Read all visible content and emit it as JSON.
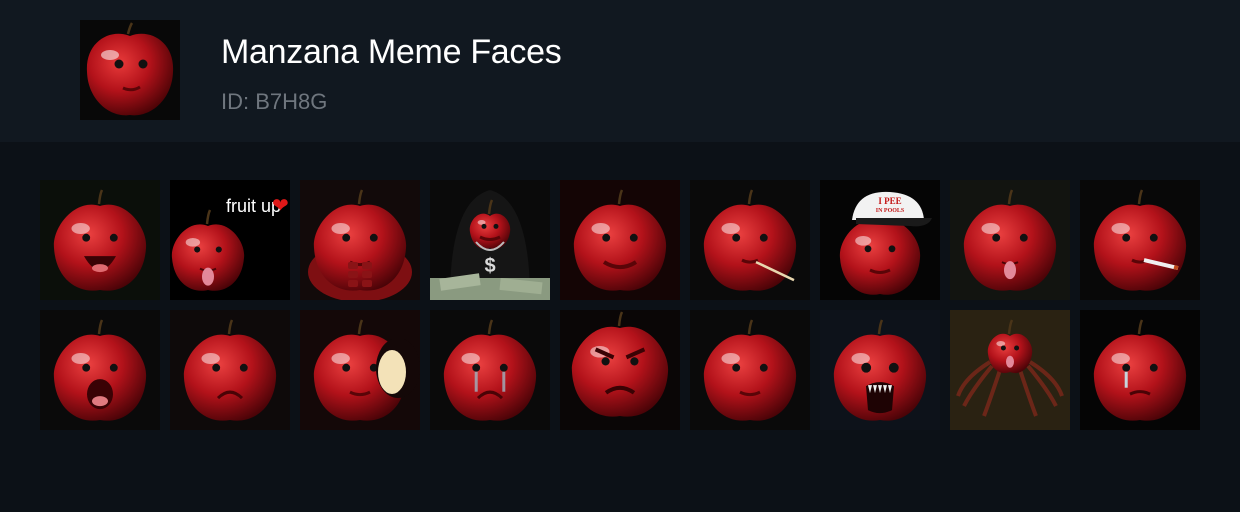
{
  "pack": {
    "title": "Manzana Meme Faces",
    "id_text": "ID: B7H8G",
    "thumbnail_icon": "apple-face-icon"
  },
  "colors": {
    "background": "#0c1117",
    "header": "#111820",
    "apple_red": "#b3121a",
    "title": "#ffffff",
    "subtitle": "#6f767e"
  },
  "stickers": [
    {
      "name": "apple-laughing",
      "expr": "laugh",
      "bg": "#0b0f0a"
    },
    {
      "name": "apple-fruit-up",
      "expr": "tongue",
      "bg": "#000000",
      "caption": "fruit up",
      "caption_emoji": "❤"
    },
    {
      "name": "apple-muscular",
      "expr": "muscle",
      "bg": "#120a0a"
    },
    {
      "name": "apple-hoodie-money",
      "expr": "hoodie",
      "bg": "#0a0a0a",
      "chain_text": "$"
    },
    {
      "name": "apple-smug",
      "expr": "smug",
      "bg": "#140505"
    },
    {
      "name": "apple-toothpick",
      "expr": "toothpick",
      "bg": "#0a0a0a"
    },
    {
      "name": "apple-trucker-cap",
      "expr": "cap",
      "bg": "#050505",
      "cap_text_1": "I PEE",
      "cap_text_2": "IN POOLS"
    },
    {
      "name": "apple-tongue-out",
      "expr": "tongue",
      "bg": "#121410"
    },
    {
      "name": "apple-cigarette",
      "expr": "cigarette",
      "bg": "#080808"
    },
    {
      "name": "apple-shocked",
      "expr": "shock",
      "bg": "#0a0a0a"
    },
    {
      "name": "apple-sad",
      "expr": "sad",
      "bg": "#0e0a0a"
    },
    {
      "name": "apple-bitten",
      "expr": "bitten",
      "bg": "#140808"
    },
    {
      "name": "apple-crying",
      "expr": "cry",
      "bg": "#0a0a0a"
    },
    {
      "name": "apple-angry",
      "expr": "angry",
      "bg": "#0a0606"
    },
    {
      "name": "apple-neutral",
      "expr": "neutral",
      "bg": "#0a0a0a"
    },
    {
      "name": "apple-screaming-fangs",
      "expr": "scream",
      "bg": "#0d121a"
    },
    {
      "name": "apple-spider-creature",
      "expr": "spider",
      "bg": "#2a2212"
    },
    {
      "name": "apple-single-tear",
      "expr": "tear",
      "bg": "#050505"
    }
  ]
}
